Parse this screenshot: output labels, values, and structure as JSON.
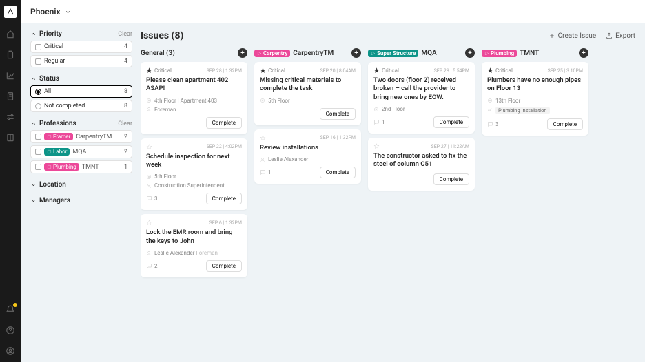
{
  "project": "Phoenix",
  "pageTitle": "Issues (8)",
  "actions": {
    "create": "Create Issue",
    "export": "Export"
  },
  "filters": {
    "priority": {
      "label": "Priority",
      "items": [
        {
          "label": "Critical",
          "count": 4
        },
        {
          "label": "Regular",
          "count": 4
        }
      ]
    },
    "status": {
      "label": "Status",
      "items": [
        {
          "label": "All",
          "count": 8,
          "active": true
        },
        {
          "label": "Not completed",
          "count": 8
        }
      ]
    },
    "professions": {
      "label": "Professions",
      "items": [
        {
          "tag": "Framer",
          "tagClass": "tag-framer",
          "text": "CarpentryTM",
          "count": 2
        },
        {
          "tag": "Labor",
          "tagClass": "tag-labor",
          "text": "MQA",
          "count": 2
        },
        {
          "tag": "Plumbing",
          "tagClass": "tag-plumbing",
          "text": "TMNT",
          "count": 1
        }
      ]
    },
    "location": {
      "label": "Location"
    },
    "managers": {
      "label": "Managers"
    },
    "clear": "Clear"
  },
  "columns": [
    {
      "title": "General (3)",
      "tag": null,
      "tagClass": null,
      "cards": [
        {
          "critical": true,
          "critLabel": "Critical",
          "date": "SEP 28 | 1:32PM",
          "title": "Please clean apartment 402 ASAP!",
          "meta": [
            {
              "icon": "loc",
              "text": "4th Floor  |  Apartment 403"
            },
            {
              "icon": "user",
              "text": "Foreman"
            }
          ],
          "comments": null,
          "complete": "Complete"
        },
        {
          "critical": false,
          "date": "SEP 22 | 4:02PM",
          "title": "Schedule inspection for next week",
          "meta": [
            {
              "icon": "loc",
              "text": "5th Floor"
            },
            {
              "icon": "user",
              "text": "Construction Superintendent"
            }
          ],
          "comments": 3,
          "complete": "Complete"
        },
        {
          "critical": false,
          "date": "SEP 6 | 1:32PM",
          "title": "Lock the EMR room and bring the keys to John",
          "meta": [
            {
              "icon": "user",
              "text": "Leslie Alexander",
              "extra": "Foreman"
            }
          ],
          "comments": 2,
          "complete": "Complete"
        }
      ]
    },
    {
      "title": "CarpentryTM",
      "tag": "Carpentry",
      "tagClass": "tag-carpentry",
      "cards": [
        {
          "critical": true,
          "critLabel": "Critical",
          "date": "SEP 20 | 8:04AM",
          "title": "Missing critical materials to complete the task",
          "meta": [
            {
              "icon": "loc",
              "text": "5th Floor"
            }
          ],
          "comments": null,
          "complete": "Complete"
        },
        {
          "critical": false,
          "date": "SEP 16 | 1:32PM",
          "title": "Review  installations",
          "meta": [
            {
              "icon": "user",
              "text": "Leslie Alexander"
            }
          ],
          "comments": 1,
          "complete": "Complete"
        }
      ]
    },
    {
      "title": "MQA",
      "tag": "Super Structure",
      "tagClass": "tag-super",
      "cards": [
        {
          "critical": true,
          "critLabel": "Critical",
          "date": "SEP 28 | 5:54PM",
          "title": "Two doors (floor 2) received broken – call the provider to bring new ones by EOW.",
          "meta": [
            {
              "icon": "loc",
              "text": "2nd Floor"
            }
          ],
          "comments": 1,
          "complete": "Complete"
        },
        {
          "critical": false,
          "date": "SEP 27 | 11:22AM",
          "title": "The constructor asked to fix the steel of column C51",
          "meta": [],
          "comments": null,
          "complete": "Complete"
        }
      ]
    },
    {
      "title": "TMNT",
      "tag": "Plumbing",
      "tagClass": "tag-plumbing",
      "cards": [
        {
          "critical": true,
          "critLabel": "Critical",
          "date": "SEP 25 | 3:10PM",
          "title": "Plumbers have no enough pipes on Floor 13",
          "meta": [
            {
              "icon": "loc",
              "text": "13th Floor"
            },
            {
              "icon": "task",
              "pill": "Plumbing Installation"
            }
          ],
          "comments": 3,
          "complete": "Complete"
        }
      ]
    }
  ]
}
